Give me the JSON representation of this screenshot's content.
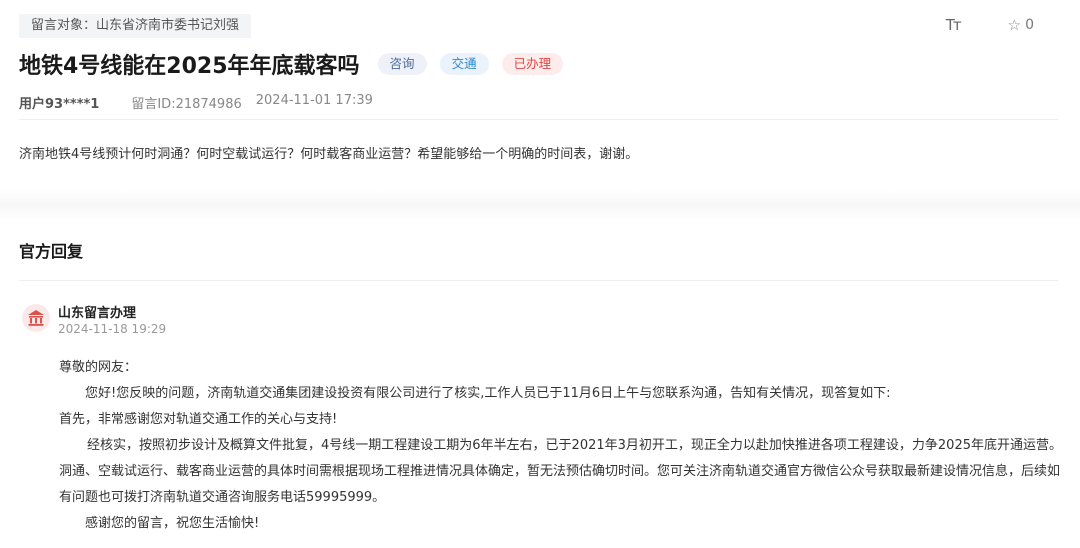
{
  "header": {
    "target_label": "留言对象：山东省济南市委书记刘强",
    "font_toggle_label": "Tт",
    "favorite_count": "0"
  },
  "post": {
    "title": "地铁4号线能在2025年年底载客吗",
    "tags": [
      "咨询",
      "交通",
      "已办理"
    ],
    "tag_colors": {
      "consult": "#4d6a9a",
      "traffic": "#2f86c8",
      "done": "#e04848"
    },
    "user": "用户93****1",
    "message_id": "留言ID:21874986",
    "date": "2024-11-01 17:39",
    "content": "济南地铁4号线预计何时洞通？何时空载试运行？何时载客商业运营？希望能够给一个明确的时间表，谢谢。"
  },
  "reply": {
    "section_title": "官方回复",
    "org_name": "山东留言办理",
    "org_icon": "government-building-icon",
    "date": "2024-11-18 19:29",
    "greeting": "尊敬的网友：",
    "para1": "您好!您反映的问题，济南轨道交通集团建设投资有限公司进行了核实,工作人员已于11月6日上午与您联系沟通，告知有关情况，现答复如下:",
    "para2": "首先，非常感谢您对轨道交通工作的关心与支持!",
    "para3": "经核实，按照初步设计及概算文件批复，4号线一期工程建设工期为6年半左右，已于2021年3月初开工，现正全力以赴加快推进各项工程建设，力争2025年底开通运营。洞通、空载试运行、载客商业运营的具体时间需根据现场工程推进情况具体确定，暂无法预估确切时间。您可关注济南轨道交通官方微信公众号获取最新建设情况信息，后续如有问题也可拨打济南轨道交通咨询服务电话59995999。",
    "para4": "感谢您的留言，祝您生活愉快!"
  }
}
